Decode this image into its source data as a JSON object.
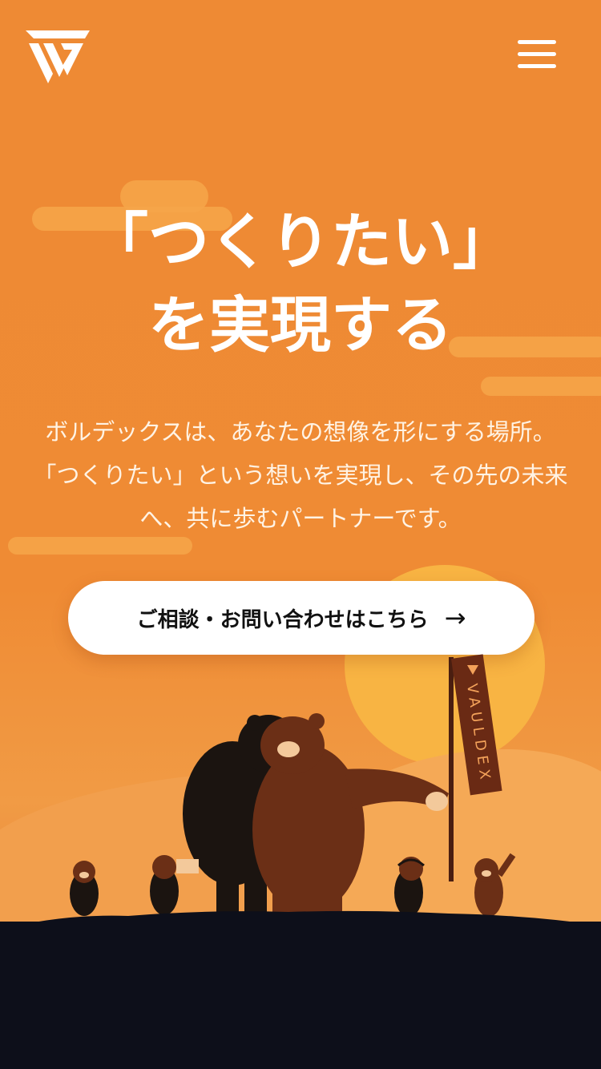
{
  "header": {
    "logo_icon": "vauldex-logo-icon",
    "menu_icon": "hamburger-menu-icon"
  },
  "hero": {
    "title_line1": "「つくりたい」",
    "title_line2": "を実現する",
    "description": "ボルデックスは、あなたの想像を形にする場所。 「つくりたい」という想いを実現し、その先の未来へ、共に歩むパートナーです。"
  },
  "cta": {
    "label": "ご相談・お問い合わせはこちら",
    "arrow": "→"
  },
  "illustration": {
    "flag_text": "VAULDEX"
  },
  "colors": {
    "background": "#ef8b34",
    "sun": "#f8b443",
    "ground": "#0d0f1a",
    "button": "#ffffff"
  }
}
